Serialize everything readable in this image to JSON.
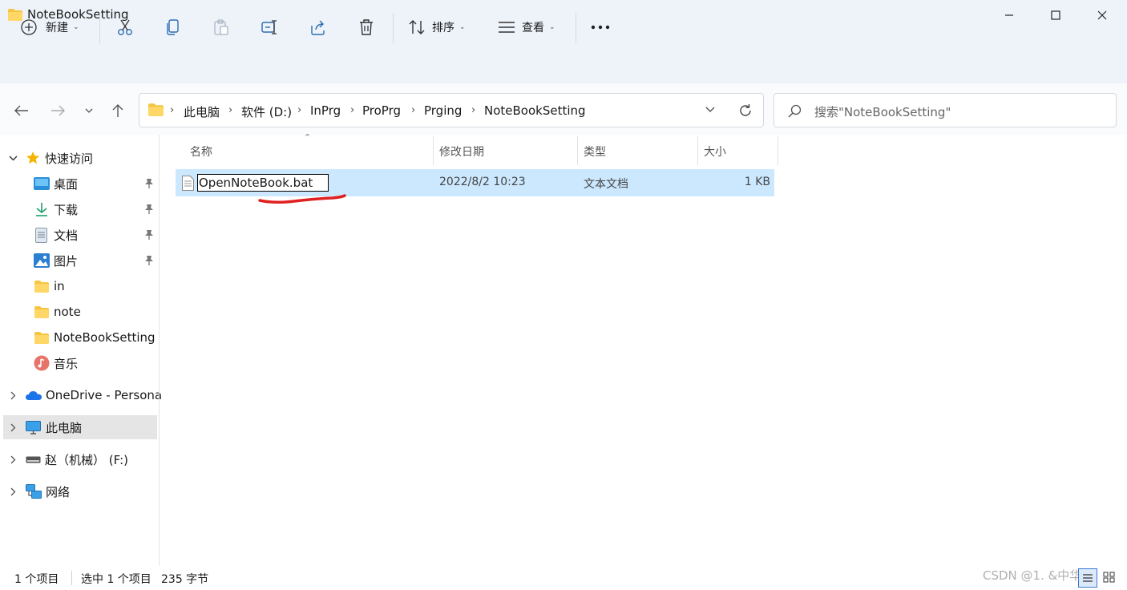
{
  "window": {
    "title": "NoteBookSetting"
  },
  "commandbar": {
    "new_label": "新建",
    "sort_label": "排序",
    "view_label": "查看"
  },
  "breadcrumbs": [
    "此电脑",
    "软件 (D:)",
    "InPrg",
    "ProPrg",
    "Prging",
    "NoteBookSetting"
  ],
  "search": {
    "placeholder": "搜索\"NoteBookSetting\""
  },
  "sidebar": {
    "quick_access": "快速访问",
    "items": [
      {
        "label": "桌面"
      },
      {
        "label": "下载"
      },
      {
        "label": "文档"
      },
      {
        "label": "图片"
      },
      {
        "label": "in"
      },
      {
        "label": "note"
      },
      {
        "label": "NoteBookSetting"
      },
      {
        "label": "音乐"
      }
    ],
    "onedrive": "OneDrive - Persona",
    "this_pc": "此电脑",
    "drive_f": "赵（机械） (F:)",
    "network": "网络"
  },
  "columns": {
    "name": "名称",
    "date": "修改日期",
    "type": "类型",
    "size": "大小"
  },
  "files": [
    {
      "name": "OpenNoteBook.bat",
      "date": "2022/8/2 10:23",
      "type": "文本文档",
      "size": "1 KB"
    }
  ],
  "status": {
    "count": "1 个项目",
    "selected": "选中 1 个项目",
    "bytes": "235 字节"
  },
  "watermark": "CSDN @1. &中华地",
  "colors": {
    "selection": "#cce8ff",
    "toolbar_bg": "#eef3f9",
    "annotation_red": "#e02020",
    "folder_yellow": "#f5c542",
    "star_yellow": "#f4b400"
  }
}
